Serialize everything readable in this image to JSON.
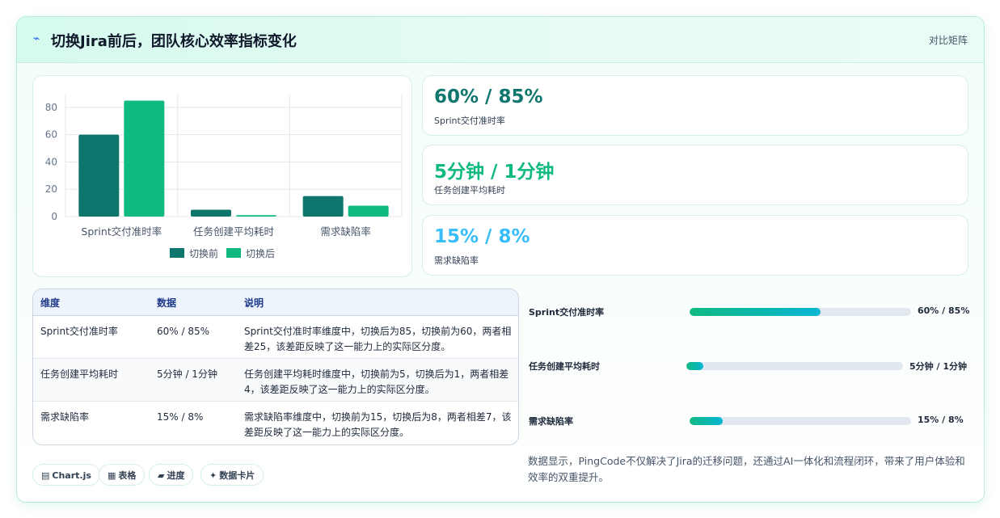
{
  "header": {
    "title": "切换Jira前后，团队核心效率指标变化",
    "tag": "对比矩阵"
  },
  "chart_data": {
    "type": "bar",
    "categories": [
      "Sprint交付准时率",
      "任务创建平均耗时",
      "需求缺陷率"
    ],
    "series": [
      {
        "name": "切换前",
        "values": [
          60,
          5,
          15
        ],
        "color": "#0f766e"
      },
      {
        "name": "切换后",
        "values": [
          85,
          1,
          8
        ],
        "color": "#10b981"
      }
    ],
    "yticks": [
      0,
      20,
      40,
      60,
      80
    ],
    "ylim": [
      0,
      90
    ],
    "legend": "bottom",
    "grid": true
  },
  "stats": [
    {
      "value": "60% / 85%",
      "label": "Sprint交付准时率",
      "color": "#0f766e"
    },
    {
      "value": "5分钟 / 1分钟",
      "label": "任务创建平均耗时",
      "color": "#10b981"
    },
    {
      "value": "15% / 8%",
      "label": "需求缺陷率",
      "color": "#38bdf8"
    }
  ],
  "table": {
    "headers": [
      "维度",
      "数据",
      "说明"
    ],
    "rows": [
      {
        "dim": "Sprint交付准时率",
        "data": "60% / 85%",
        "desc": "Sprint交付准时率维度中，切换后为85，切换前为60，两者相差25，该差距反映了这一能力上的实际区分度。"
      },
      {
        "dim": "任务创建平均耗时",
        "data": "5分钟 / 1分钟",
        "desc": "任务创建平均耗时维度中，切换前为5，切换后为1，两者相差4，该差距反映了这一能力上的实际区分度。"
      },
      {
        "dim": "需求缺陷率",
        "data": "15% / 8%",
        "desc": "需求缺陷率维度中，切换前为15，切换后为8，两者相差7，该差距反映了这一能力上的实际区分度。"
      }
    ]
  },
  "progress": [
    {
      "label": "Sprint交付准时率",
      "value": "60% / 85%",
      "fill_fraction": 0.59
    },
    {
      "label": "任务创建平均耗时",
      "value": "5分钟 / 1分钟",
      "fill_fraction": 0.08
    },
    {
      "label": "需求缺陷率",
      "value": "15% / 8%",
      "fill_fraction": 0.15
    }
  ],
  "summary": "数据显示，PingCode不仅解决了Jira的迁移问题，还通过AI一体化和流程闭环，带来了用户体验和效率的双重提升。",
  "chips": [
    {
      "icon": "chart-icon",
      "glyph": "▤",
      "label": "Chart.js"
    },
    {
      "icon": "table-icon",
      "glyph": "▦",
      "label": "表格"
    },
    {
      "icon": "progress-icon",
      "glyph": "▰",
      "label": "进度"
    },
    {
      "icon": "sparkle-icon",
      "glyph": "✦",
      "label": "数据卡片"
    }
  ]
}
